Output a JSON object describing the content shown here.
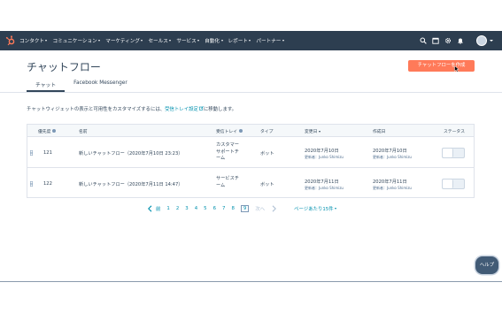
{
  "topnav": {
    "items": [
      "コンタクト",
      "コミュニケーション",
      "マーケティング",
      "セールス",
      "サービス",
      "自動化",
      "レポート",
      "パートナー"
    ],
    "icons": [
      "search-icon",
      "marketplace-icon",
      "settings-icon",
      "notifications-icon"
    ]
  },
  "page": {
    "title": "チャットフロー",
    "create_button": "チャットフローを作成"
  },
  "tabs": [
    {
      "label": "チャット",
      "active": true
    },
    {
      "label": "Facebook Messenger",
      "active": false
    }
  ],
  "description": {
    "text": "チャットウィジェットの表示と可用性をカスタマイズするには、",
    "link": "受信トレイ設定",
    "suffix": "に移動します。"
  },
  "table": {
    "headers": [
      "優先度",
      "名前",
      "受信トレイ",
      "タイプ",
      "変更日",
      "作成日",
      "ステータス"
    ],
    "rows": [
      {
        "priority": "121",
        "name": "新しいチャットフロー（2020年7月10日 23:23）",
        "inbox_lines": [
          "カスタマー",
          "サポートチ",
          "ーム"
        ],
        "type": "ボット",
        "modified_date": "2020年7月10日",
        "modified_by": "更新者：Junko Shimizu",
        "created_date": "2020年7月10日",
        "created_by": "更新者：Junko Shimizu"
      },
      {
        "priority": "122",
        "name": "新しいチャットフロー（2020年7月11日 14:47）",
        "inbox_lines": [
          "サービスチ",
          "ーム"
        ],
        "type": "ボット",
        "modified_date": "2020年7月11日",
        "modified_by": "更新者：Junko Shimizu",
        "created_date": "2020年7月11日",
        "created_by": "更新者：Junko Shimizu"
      }
    ]
  },
  "pagination": {
    "prev": "前",
    "pages": [
      "1",
      "2",
      "3",
      "4",
      "5",
      "6",
      "7",
      "8",
      "9"
    ],
    "current": "9",
    "next": "次へ",
    "per_page": "ページあたり15件"
  },
  "help_button": "ヘルプ",
  "colors": {
    "topbar": "#2d3e50",
    "accent": "#ff7a59",
    "link": "#0091ae",
    "help": "#425b76"
  }
}
